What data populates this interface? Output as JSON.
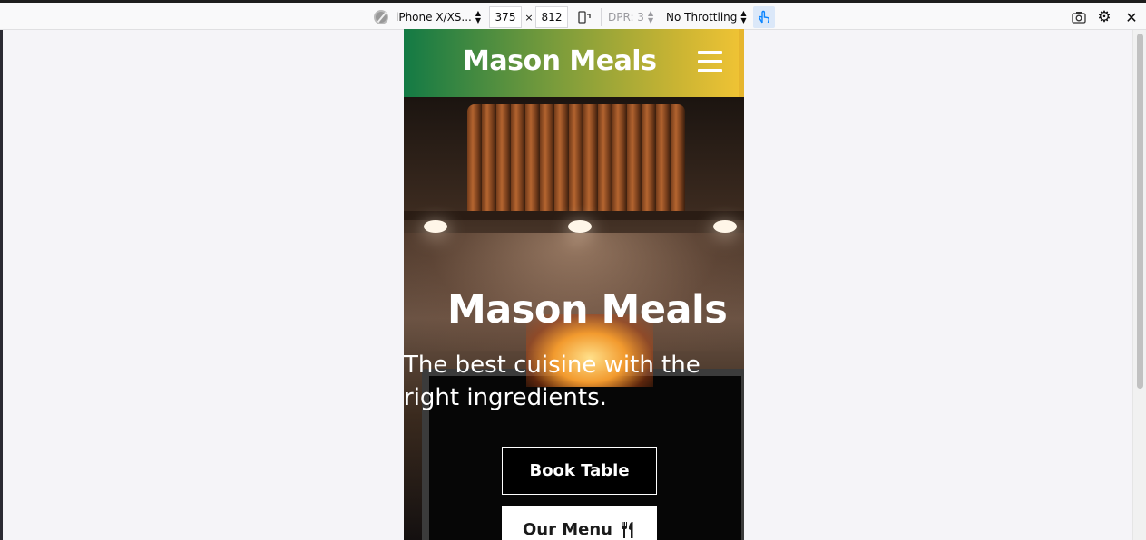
{
  "toolbar": {
    "device": "iPhone X/XS...",
    "width": "375",
    "times": "×",
    "height": "812",
    "dpr": "DPR: 3",
    "throttling": "No Throttling"
  },
  "site": {
    "brand": "Mason Meals",
    "hero_title": "Mason Meals",
    "hero_subtitle": "The best cuisine with the right ingredients.",
    "book_button": "Book Table",
    "menu_button": "Our Menu"
  },
  "colors": {
    "header_gradient_start": "#137a45",
    "header_gradient_end": "#f2c434",
    "toolbar_bg": "#f9f9fa",
    "touch_active": "#0a84ff"
  },
  "icons": [
    "globe-icon",
    "rotate-icon",
    "touch-icon",
    "screenshot-icon",
    "settings-icon",
    "close-icon",
    "hamburger-menu-icon",
    "utensils-icon"
  ]
}
